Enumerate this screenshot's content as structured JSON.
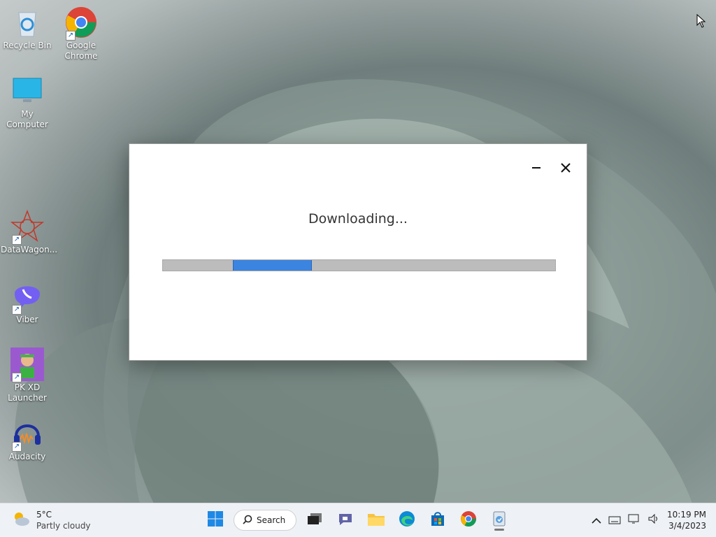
{
  "desktop": {
    "icons": [
      {
        "label": "Recycle Bin"
      },
      {
        "label": "Google Chrome"
      },
      {
        "label": "My Computer"
      },
      {
        "label": "DataWagon..."
      },
      {
        "label": "Viber"
      },
      {
        "label": "PK XD Launcher"
      },
      {
        "label": "Audacity"
      }
    ]
  },
  "dialog": {
    "status_text": "Downloading...",
    "minimize_label": "–",
    "close_label": "✕"
  },
  "taskbar": {
    "weather": {
      "temp": "5°C",
      "condition": "Partly cloudy"
    },
    "search_label": "Search",
    "clock": {
      "time": "10:19 PM",
      "date": "3/4/2023"
    }
  }
}
